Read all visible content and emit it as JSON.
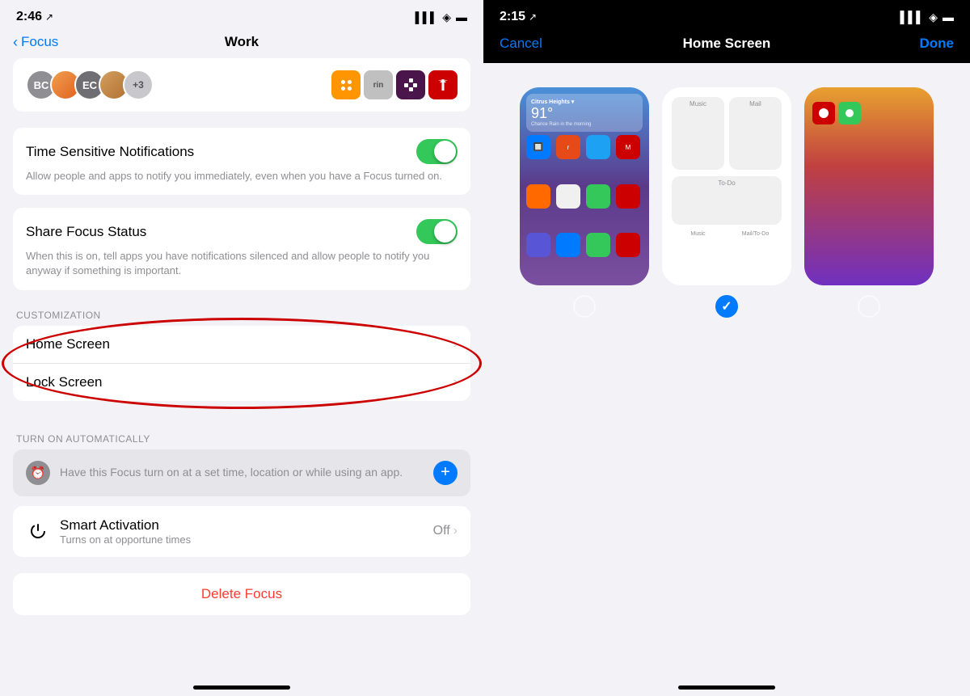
{
  "left": {
    "statusBar": {
      "time": "2:46",
      "locationIcon": "▶",
      "signal": "▌▌▌",
      "wifi": "wifi",
      "battery": "battery"
    },
    "nav": {
      "backLabel": "Focus",
      "title": "Work"
    },
    "avatars": [
      {
        "initials": "BC",
        "type": "initials"
      },
      {
        "initials": "",
        "type": "photo1"
      },
      {
        "initials": "EC",
        "type": "initials"
      },
      {
        "initials": "",
        "type": "photo2"
      },
      {
        "initials": "+3",
        "type": "plus"
      }
    ],
    "timeSensitive": {
      "label": "Time Sensitive Notifications",
      "description": "Allow people and apps to notify you immediately, even when you have a Focus turned on.",
      "toggleOn": true
    },
    "shareFocus": {
      "label": "Share Focus Status",
      "description": "When this is on, tell apps you have notifications silenced and allow people to notify you anyway if something is important.",
      "toggleOn": true
    },
    "customization": {
      "sectionLabel": "CUSTOMIZATION",
      "items": [
        {
          "label": "Home Screen"
        },
        {
          "label": "Lock Screen"
        }
      ]
    },
    "turnOnAutomatically": {
      "sectionLabel": "TURN ON AUTOMATICALLY",
      "autoCard": {
        "text": "Have this Focus turn on at a set time, location or while using an app."
      }
    },
    "smartActivation": {
      "label": "Smart Activation",
      "subLabel": "Turns on at opportune times",
      "valueLabel": "Off"
    },
    "deleteFocus": {
      "label": "Delete Focus"
    }
  },
  "right": {
    "statusBar": {
      "time": "2:15",
      "locationIcon": "▶",
      "signal": "▌▌▌",
      "wifi": "wifi",
      "battery": "battery"
    },
    "nav": {
      "cancelLabel": "Cancel",
      "title": "Home Screen",
      "doneLabel": "Done"
    },
    "previews": [
      {
        "type": "app-grid",
        "widgetCity": "Citrus Heights",
        "widgetTemp": "91°",
        "widgetSub": "Chance Rain in the morning",
        "selected": false
      },
      {
        "type": "blank",
        "label1": "Music",
        "label2": "Mail/To-Do",
        "selected": true
      },
      {
        "type": "minimal",
        "selected": false
      }
    ]
  }
}
